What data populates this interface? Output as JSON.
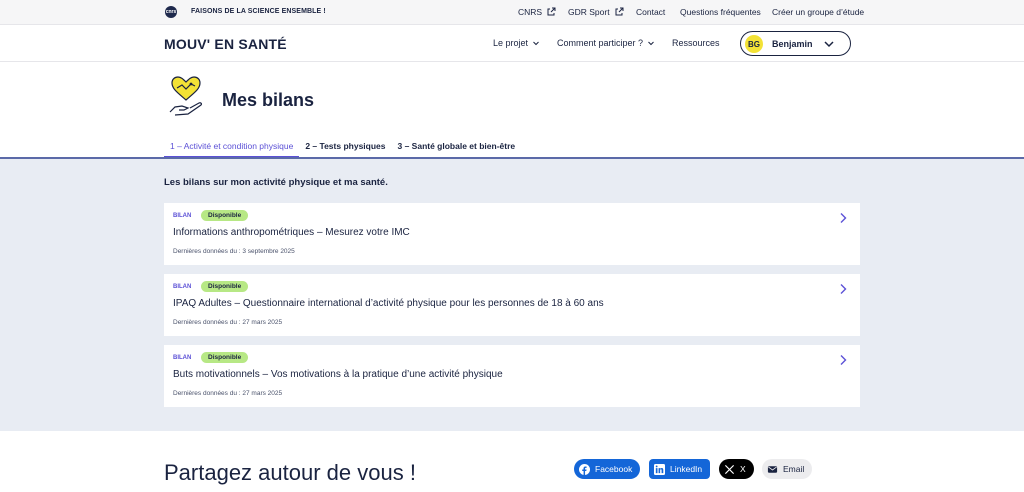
{
  "topbar": {
    "logo_text": "cnrs",
    "tagline": "FAISONS DE LA SCIENCE ENSEMBLE !",
    "links": [
      "CNRS",
      "GDR Sport",
      "Contact",
      "Questions fréquentes",
      "Créer un groupe d’étude"
    ]
  },
  "header": {
    "brand": "MOUV' EN SANTÉ",
    "nav": [
      "Le projet",
      "Comment participer ?",
      "Ressources"
    ],
    "user": {
      "initials": "BG",
      "name": "Benjamin"
    }
  },
  "page": {
    "title": "Mes bilans"
  },
  "tabs": [
    "1 – Activité et condition physique",
    "2 – Tests physiques",
    "3 – Santé globale et bien-être"
  ],
  "section": {
    "title": "Les bilans sur mon activité physique et ma santé.",
    "cards": [
      {
        "kind": "BILAN",
        "badge": "Disponible",
        "title": "Informations anthropométriques – Mesurez votre IMC",
        "date": "Dernières données du : 3 septembre 2025"
      },
      {
        "kind": "BILAN",
        "badge": "Disponible",
        "title": "IPAQ Adultes – Questionnaire international d’activité physique pour les personnes de 18 à 60 ans",
        "date": "Dernières données du : 27 mars 2025"
      },
      {
        "kind": "BILAN",
        "badge": "Disponible",
        "title": "Buts motivationnels – Vos motivations à la pratique d’une activité physique",
        "date": "Dernières données du : 27 mars 2025"
      }
    ]
  },
  "share": {
    "title": "Partagez autour de vous !",
    "buttons": [
      "Facebook",
      "LinkedIn",
      "X",
      "Email"
    ]
  },
  "colors": {
    "accent": "#5b50d6",
    "badge": "#b7e885",
    "content_bg": "#e8ecf3",
    "avatar": "#f3e236",
    "facebook": "#1466d8"
  }
}
